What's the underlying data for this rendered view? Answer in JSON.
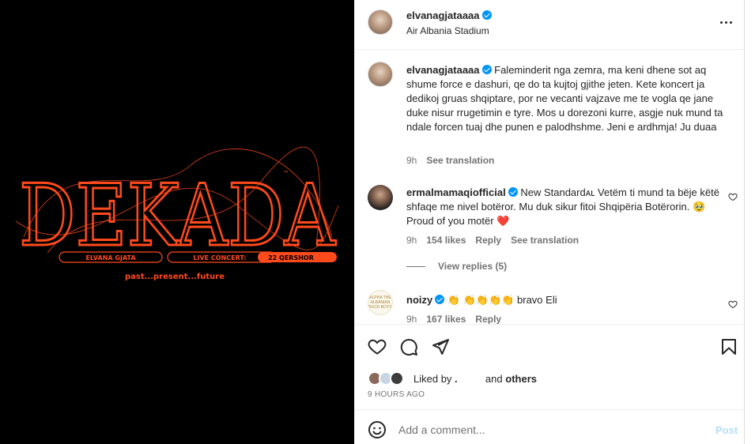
{
  "media": {
    "logo_text": "DEKADA",
    "trademark": "™",
    "artist": "ELVANA GJATA",
    "event": "LIVE CONCERT:",
    "date": "22 QERSHOR",
    "tagline": "past...present...future",
    "accent_color": "#ff4a1c"
  },
  "header": {
    "username": "elvanagjataaaa",
    "location": "Air Albania Stadium",
    "more_icon": "more-horizontal-icon"
  },
  "caption": {
    "username": "elvanagjataaaa",
    "text": "Faleminderit nga zemra, ma keni dhene sot aq shume force e dashuri, qe do ta kujtoj gjithe jeten. Kete koncert ja dedikoj gruas shqiptare, por ne vecanti vajzave me te vogla qe jane duke nisur rrugetimin e tyre. Mos u dorezoni kurre, asgje nuk mund ta ndale forcen tuaj dhe punen e palodhshme. Jeni e ardhmja! Ju duaa",
    "time": "9h",
    "see_translation": "See translation"
  },
  "comments": [
    {
      "username": "ermalmamaqiofficial",
      "text": "New Standardᴀʟ Vetëm ti mund ta bëje këtë shfaqe me nivel botëror. Mu duk sikur fitoi Shqipëria Botërorin. 🥹 Proud of you motër ❤️",
      "time": "9h",
      "likes": "154 likes",
      "reply": "Reply",
      "see_translation": "See translation",
      "view_replies": "View replies (5)"
    },
    {
      "username": "noizy",
      "text": "👏 👏👏👏👏 bravo Eli",
      "time": "9h",
      "likes": "167 likes",
      "reply": "Reply",
      "avatar_text": "ALPHA THE ALBANIAN BUCK BOYS"
    }
  ],
  "likes": {
    "liked_by": "Liked by",
    "hidden_user": ".",
    "and": "and",
    "others": "others",
    "time_ago": "9 HOURS AGO"
  },
  "add_comment": {
    "placeholder": "Add a comment...",
    "post": "Post"
  },
  "icons": {
    "like": "heart-icon",
    "comment": "comment-icon",
    "share": "share-icon",
    "save": "bookmark-icon",
    "emoji": "emoji-icon",
    "verified": "verified-badge-icon"
  },
  "colors": {
    "verified": "#0095f6",
    "link_muted": "#737373",
    "post_disabled": "#b2dffc"
  }
}
